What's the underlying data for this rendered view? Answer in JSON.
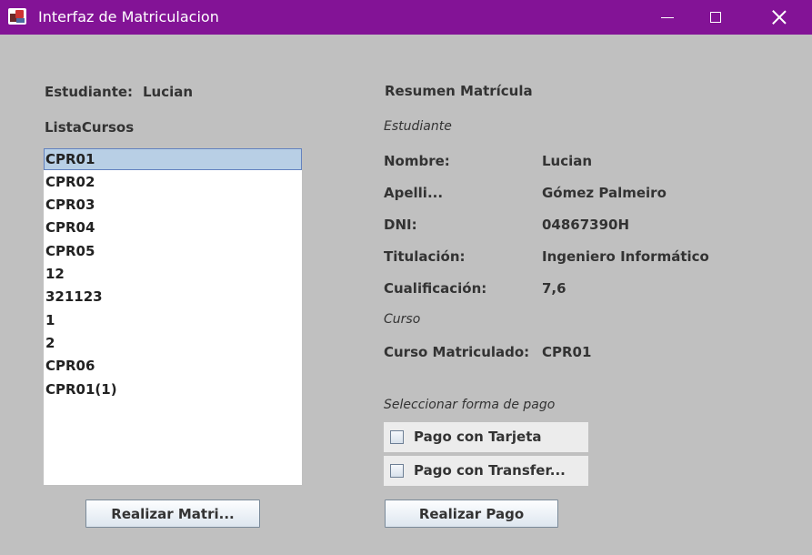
{
  "window": {
    "title": "Interfaz de Matriculacion"
  },
  "left": {
    "student_label": "Estudiante:",
    "student_name": "Lucian",
    "list_title": "ListaCursos",
    "courses": [
      "CPR01",
      "CPR02",
      "CPR03",
      "CPR04",
      "CPR05",
      "12",
      "321123",
      "1",
      "2",
      "CPR06",
      "CPR01(1)"
    ],
    "selected_index": 0,
    "enroll_button": "Realizar Matri..."
  },
  "summary": {
    "title": "Resumen Matrícula",
    "student_section": "Estudiante",
    "fields": [
      {
        "label": "Nombre:",
        "value": "Lucian"
      },
      {
        "label": "Apelli...",
        "value": "Gómez Palmeiro"
      },
      {
        "label": "DNI:",
        "value": "04867390H"
      },
      {
        "label": "Titulación:",
        "value": "Ingeniero Informático"
      },
      {
        "label": "Cualificación:",
        "value": "7,6"
      }
    ],
    "course_section": "Curso",
    "course_label": "Curso Matriculado:",
    "course_value": "CPR01"
  },
  "payment": {
    "title": "Seleccionar forma de pago",
    "options": [
      {
        "label": "Pago con Tarjeta",
        "checked": false
      },
      {
        "label": "Pago con Transfer...",
        "checked": false
      }
    ],
    "pay_button": "Realizar Pago"
  },
  "colors": {
    "titlebar": "#831396",
    "background": "#c0c0c0",
    "selection": "#b8cfe5"
  }
}
